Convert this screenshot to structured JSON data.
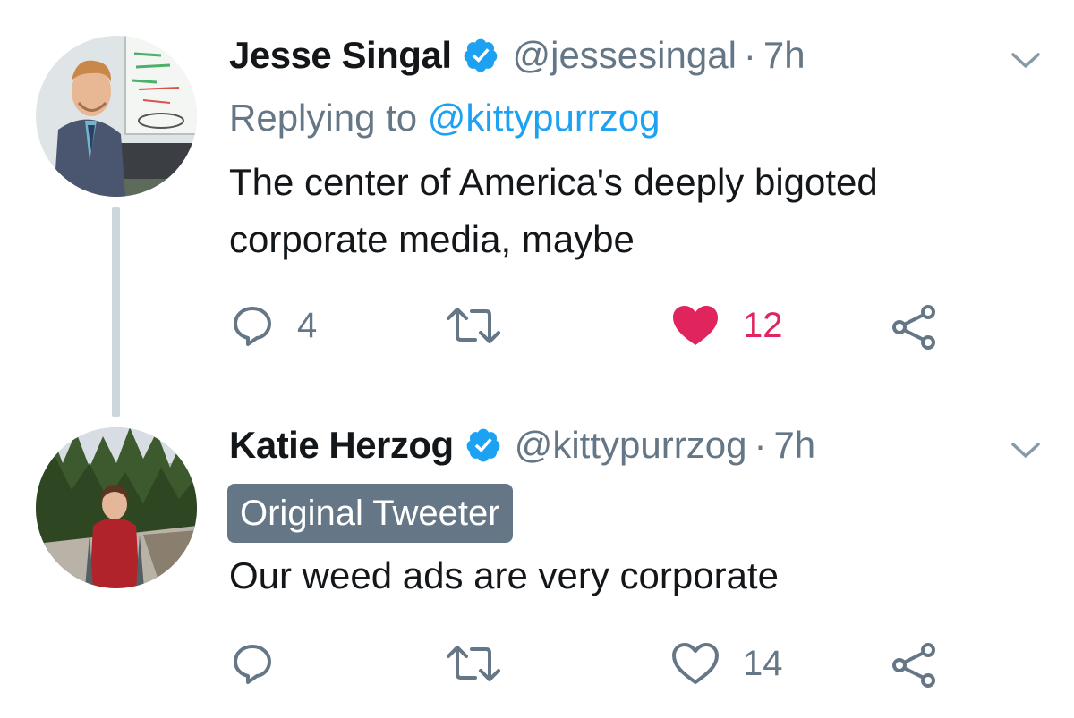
{
  "tweets": [
    {
      "display_name": "Jesse Singal",
      "handle": "@jessesingal",
      "separator": "·",
      "time": "7h",
      "verified": true,
      "replying_label": "Replying to ",
      "replying_handle": "@kittypurrzog",
      "text": "The center of America's deeply bigoted corporate media, maybe",
      "actions": {
        "reply_count": "4",
        "retweet_count": "",
        "like_count": "12",
        "liked": true
      }
    },
    {
      "display_name": "Katie Herzog",
      "handle": "@kittypurrzog",
      "separator": "·",
      "time": "7h",
      "verified": true,
      "badge": "Original Tweeter",
      "text": "Our weed ads are very corporate",
      "actions": {
        "reply_count": "",
        "retweet_count": "",
        "like_count": "14",
        "liked": false
      }
    }
  ],
  "colors": {
    "text": "#14171a",
    "muted": "#657786",
    "link": "#1da1f2",
    "like": "#e0245e",
    "badge_bg": "#657786",
    "thread_line": "#ccd6dd"
  },
  "icons": {
    "verified": "verified-badge-icon",
    "caret": "chevron-down-icon",
    "reply": "reply-icon",
    "retweet": "retweet-icon",
    "like": "heart-icon",
    "share": "share-icon"
  }
}
